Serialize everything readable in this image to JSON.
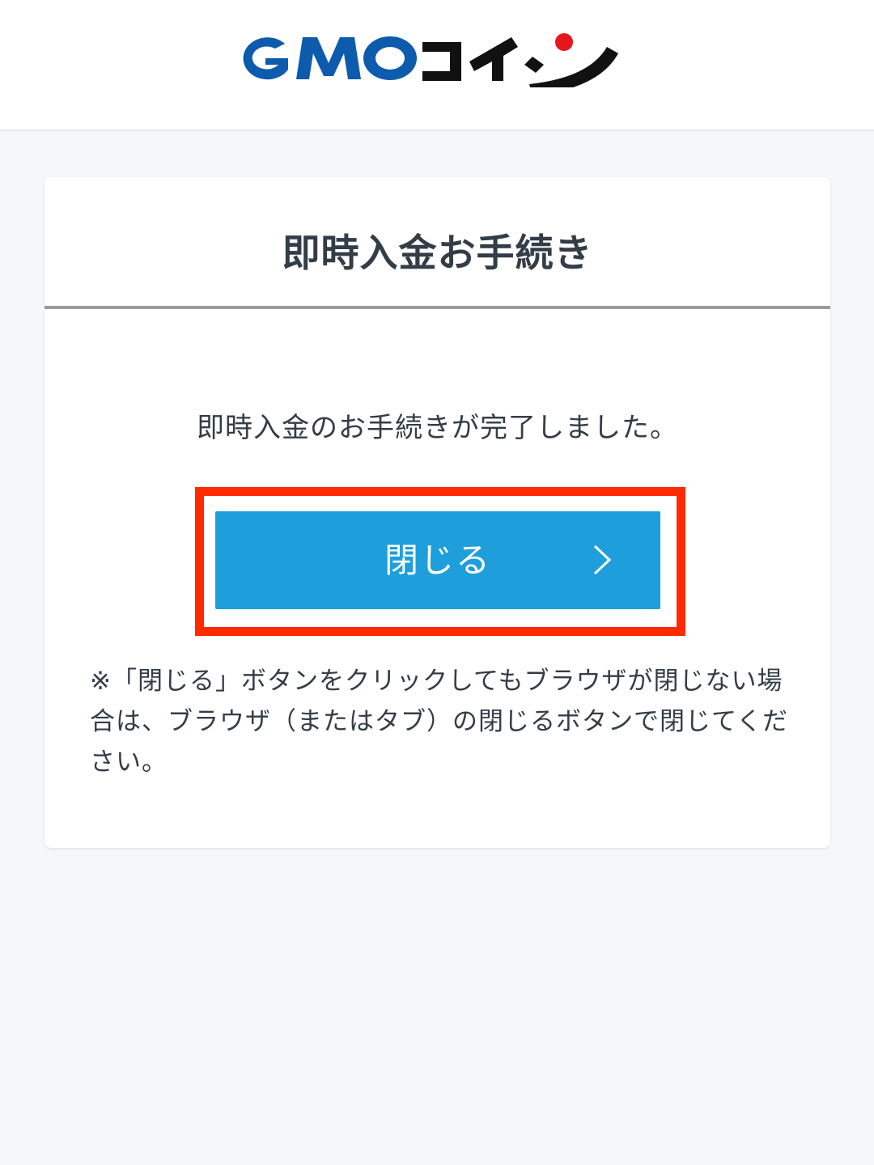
{
  "header": {
    "logo_text": "GMOコイン",
    "colors": {
      "logo_blue": "#0c5bac",
      "logo_black": "#111111",
      "logo_red_dot": "#e6161d"
    }
  },
  "card": {
    "title": "即時入金お手続き",
    "message": "即時入金のお手続きが完了しました。",
    "close_button": {
      "label": "閉じる",
      "icon": "chevron-right-icon"
    },
    "note": "※「閉じる」ボタンをクリックしてもブラウザが閉じない場合は、ブラウザ（またはタブ）の閉じるボタンで閉じてください。"
  },
  "colors": {
    "button": "#1e9fdc",
    "highlight_frame": "#ff2a00",
    "text": "#333d47",
    "page_background": "#f6f7f9"
  }
}
